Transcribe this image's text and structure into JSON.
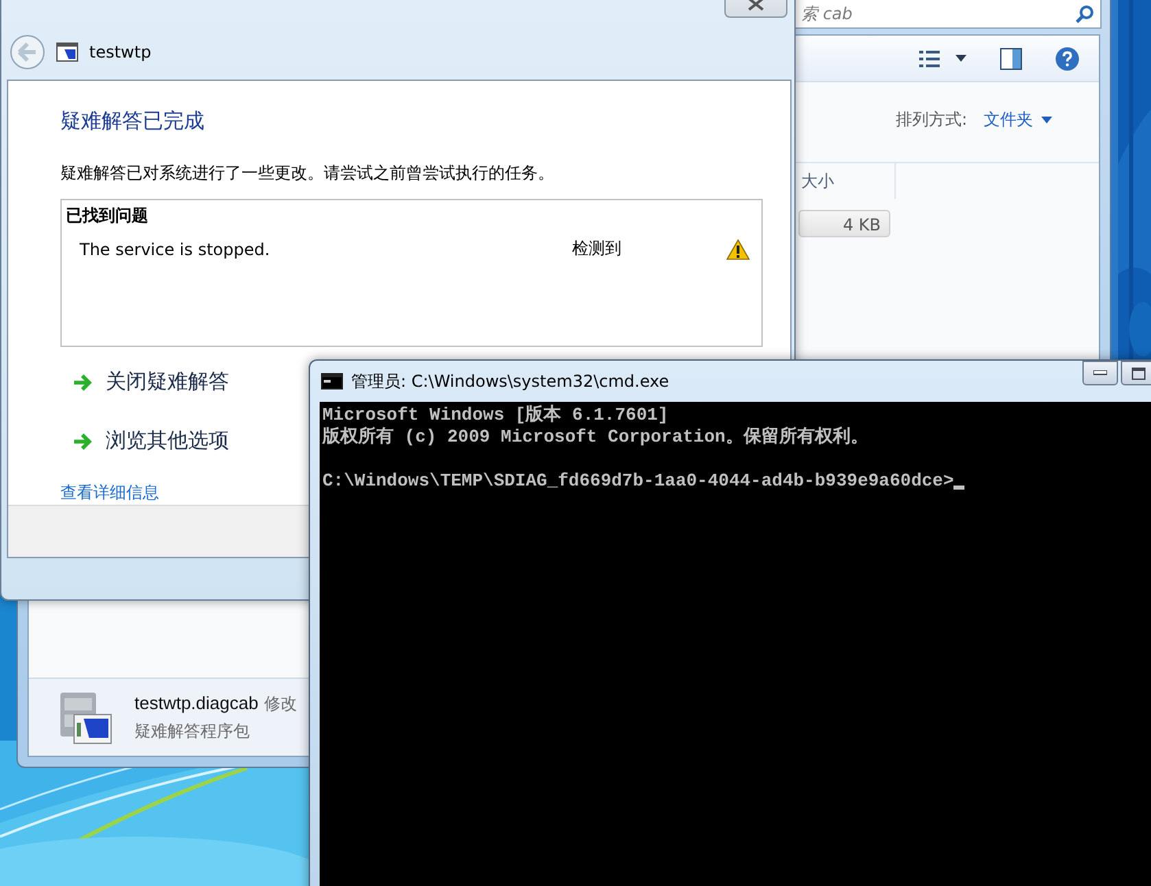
{
  "explorer": {
    "search_placeholder": "索 cab",
    "sort_label": "排列方式:",
    "sort_value": "文件夹",
    "columns": [
      {
        "label": "大小"
      }
    ],
    "rows": [
      {
        "size": "4 KB",
        "selected": true
      }
    ],
    "details": {
      "file_name": "testwtp.diagcab",
      "meta": "修改",
      "type": "疑难解答程序包"
    }
  },
  "troubleshooter": {
    "title": "testwtp",
    "heading": "疑难解答已完成",
    "description": "疑难解答已对系统进行了一些更改。请尝试之前曾尝试执行的任务。",
    "problems_header": "已找到问题",
    "problems": [
      {
        "text": "The service is stopped.",
        "status": "检测到",
        "kind": "warning"
      }
    ],
    "actions": [
      {
        "label": "关闭疑难解答"
      },
      {
        "label": "浏览其他选项"
      }
    ],
    "details_link": "查看详细信息"
  },
  "console": {
    "title": "管理员: C:\\Windows\\system32\\cmd.exe",
    "banner": [
      "Microsoft Windows [版本 6.1.7601]",
      "版权所有 (c) 2009 Microsoft Corporation。保留所有权利。"
    ],
    "prompt": "C:\\Windows\\TEMP\\SDIAG_fd669d7b-1aa0-4044-ad4b-b939e9a60dce>",
    "cursor": true
  }
}
